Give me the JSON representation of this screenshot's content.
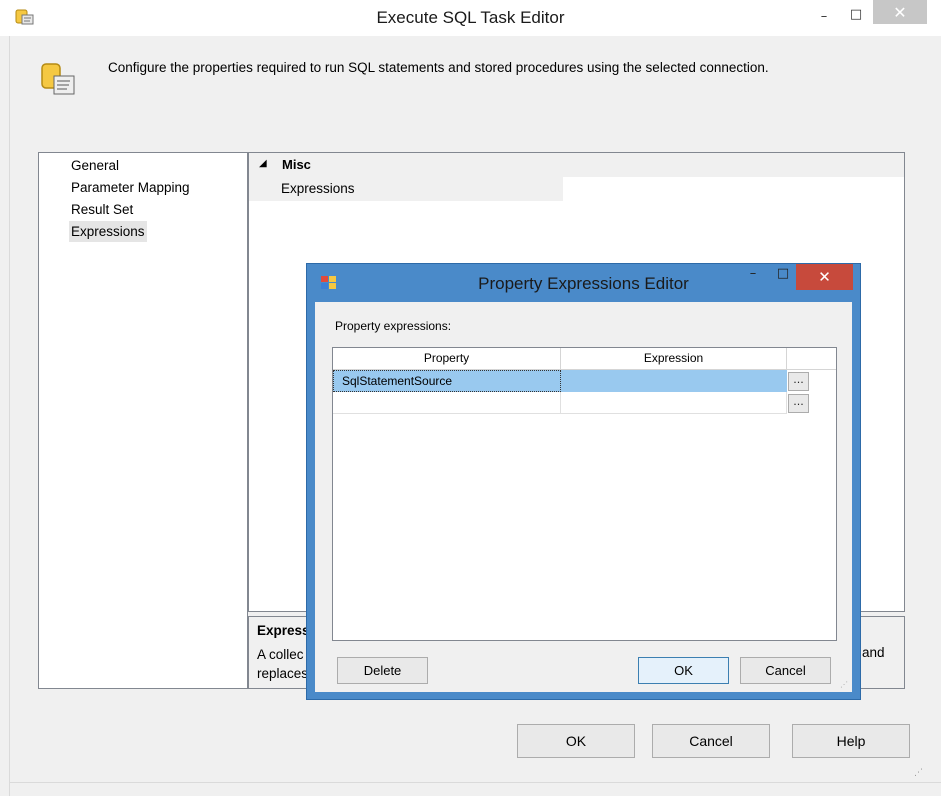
{
  "window": {
    "title": "Execute SQL Task Editor",
    "minimize": "–",
    "maximize": "□",
    "close": "✕"
  },
  "header": {
    "description": "Configure the properties required to run SQL statements and stored procedures using the selected connection."
  },
  "nav": {
    "items": [
      {
        "label": "General",
        "selected": false
      },
      {
        "label": "Parameter Mapping",
        "selected": false
      },
      {
        "label": "Result Set",
        "selected": false
      },
      {
        "label": "Expressions",
        "selected": true
      }
    ]
  },
  "properties": {
    "category": "Misc",
    "rows": [
      {
        "name": "Expressions",
        "value": ""
      }
    ]
  },
  "description_panel": {
    "title": "Express",
    "text_line1": "A collec",
    "text_line2": "replaces",
    "text_tail": "and"
  },
  "buttons": {
    "ok": "OK",
    "cancel": "Cancel",
    "help": "Help"
  },
  "dialog": {
    "title": "Property Expressions Editor",
    "minimize": "–",
    "maximize": "□",
    "close": "✕",
    "label": "Property expressions:",
    "columns": [
      "Property",
      "Expression"
    ],
    "rows": [
      {
        "property": "SqlStatementSource",
        "expression": "",
        "selected": true
      },
      {
        "property": "",
        "expression": "",
        "selected": false
      }
    ],
    "ellipsis": "...",
    "delete": "Delete",
    "ok": "OK",
    "cancel": "Cancel"
  }
}
